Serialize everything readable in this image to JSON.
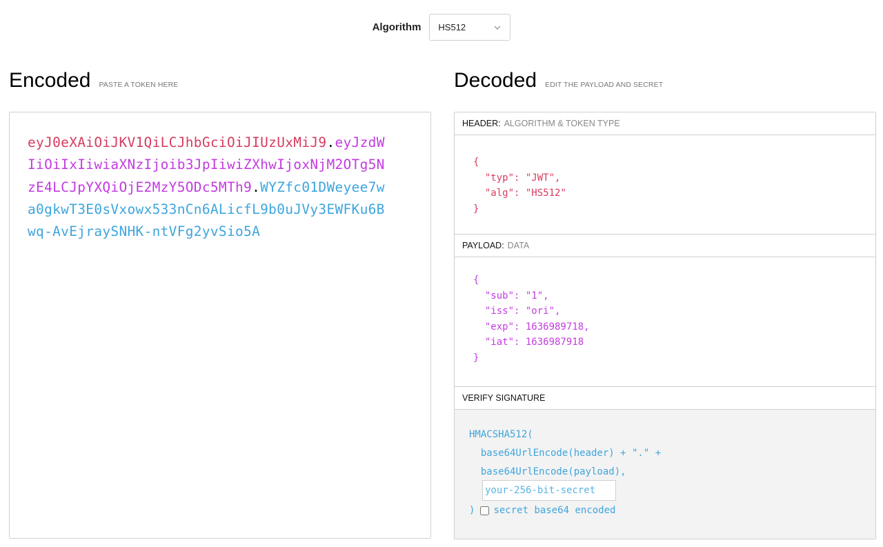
{
  "algorithm": {
    "label": "Algorithm",
    "selected": "HS512"
  },
  "encoded": {
    "title": "Encoded",
    "subtitle": "PASTE A TOKEN HERE",
    "token_header": "eyJ0eXAiOiJKV1QiLCJhbGciOiJIUzUxMiJ9",
    "token_payload": "eyJzdWIiOiIxIiwiaXNzIjoib3JpIiwiZXhwIjoxNjM2OTg5NzE4LCJpYXQiOjE2MzY5ODc5MTh9",
    "token_signature": "WYZfc01DWeyee7wa0gkwT3E0sVxowx533nCn6ALicfL9b0uJVy3EWFKu6Bwq-AvEjraySNHK-ntVFg2yvSio5A",
    "dot": "."
  },
  "decoded": {
    "title": "Decoded",
    "subtitle": "EDIT THE PAYLOAD AND SECRET",
    "header_section": {
      "label": "HEADER:",
      "note": "ALGORITHM & TOKEN TYPE",
      "json": "{\n  \"typ\": \"JWT\",\n  \"alg\": \"HS512\"\n}"
    },
    "payload_section": {
      "label": "PAYLOAD:",
      "note": "DATA",
      "json": "{\n  \"sub\": \"1\",\n  \"iss\": \"ori\",\n  \"exp\": 1636989718,\n  \"iat\": 1636987918\n}"
    },
    "signature_section": {
      "label": "VERIFY SIGNATURE",
      "code": "HMACSHA512(\n  base64UrlEncode(header) + \".\" +\n  base64UrlEncode(payload),",
      "secret_placeholder": "your-256-bit-secret",
      "closing": ")",
      "checkbox_label": "secret base64 encoded"
    }
  },
  "colors": {
    "header": "#d63c5e",
    "payload": "#c33be0",
    "signature": "#3ea5dd"
  }
}
